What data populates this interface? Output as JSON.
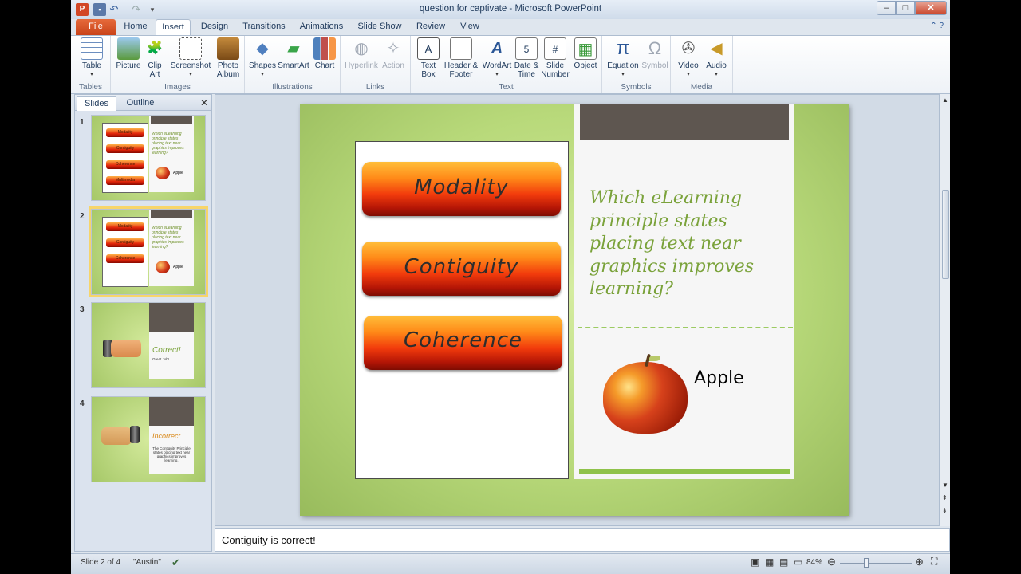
{
  "window": {
    "title": "question for captivate - Microsoft PowerPoint"
  },
  "tabs": [
    "File",
    "Home",
    "Insert",
    "Design",
    "Transitions",
    "Animations",
    "Slide Show",
    "Review",
    "View"
  ],
  "ribbon": {
    "groups": {
      "tables": "Tables",
      "images": "Images",
      "illustrations": "Illustrations",
      "links": "Links",
      "text": "Text",
      "symbols": "Symbols",
      "media": "Media"
    },
    "buttons": {
      "table": "Table",
      "picture": "Picture",
      "clipart": "Clip Art",
      "screenshot": "Screenshot",
      "photoalbum": "Photo Album",
      "shapes": "Shapes",
      "smartart": "SmartArt",
      "chart": "Chart",
      "hyperlink": "Hyperlink",
      "action": "Action",
      "textbox": "Text Box",
      "headerfooter": "Header & Footer",
      "wordart": "WordArt",
      "datetime": "Date & Time",
      "slidenumber": "Slide Number",
      "object": "Object",
      "equation": "Equation",
      "symbol": "Symbol",
      "video": "Video",
      "audio": "Audio"
    }
  },
  "panel": {
    "tab_slides": "Slides",
    "tab_outline": "Outline",
    "thumbs": [
      {
        "num": "1",
        "pills": [
          "Modality",
          "Contiguity",
          "Coherence",
          "Multimedia"
        ],
        "question": "Which eLearning principle states placing text near graphics improves learning?",
        "apple": "Apple"
      },
      {
        "num": "2",
        "pills": [
          "Modality",
          "Contiguity",
          "Coherence"
        ],
        "question": "Which eLearning principle states placing text near graphics improves learning?",
        "apple": "Apple"
      },
      {
        "num": "3",
        "big": "Correct!",
        "small": "Great Job!"
      },
      {
        "num": "4",
        "big": "Incorrect",
        "small": "The Contiguity Principle states placing text near graphics improves learning."
      }
    ]
  },
  "slide": {
    "answers": [
      "Modality",
      "Contiguity",
      "Coherence"
    ],
    "question": "Which eLearning principle states placing text near graphics improves learning?",
    "image_label": "Apple"
  },
  "notes": "Contiguity is correct!",
  "status": {
    "slide_info": "Slide 2 of 4",
    "theme": "\"Austin\"",
    "zoom": "84%"
  },
  "colors": {
    "accent_green": "#7aa23a",
    "file_tab": "#d24726"
  }
}
